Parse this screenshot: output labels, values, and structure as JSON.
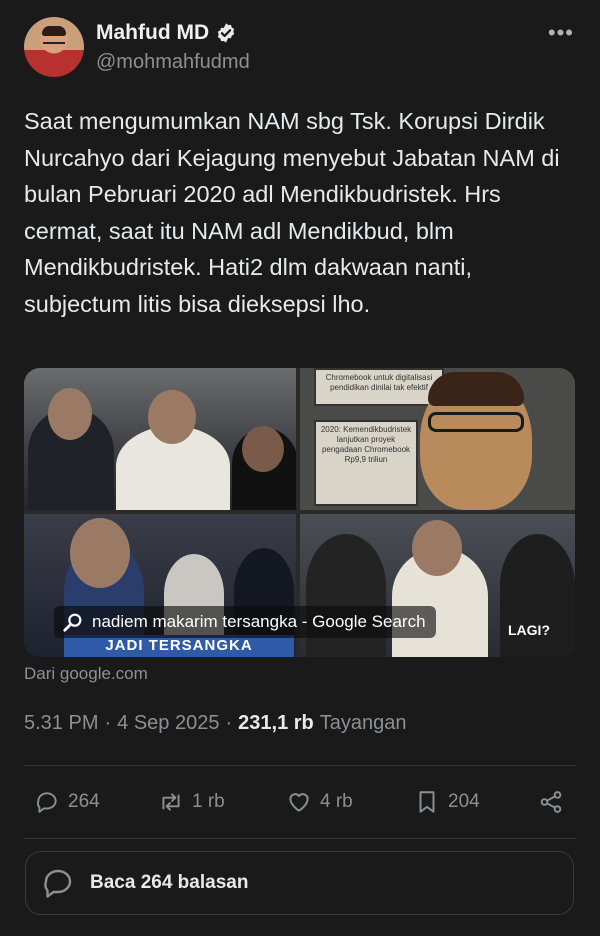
{
  "author": {
    "name": "Mahfud MD",
    "handle": "@mohmahfudmd"
  },
  "tweet": {
    "text": "Saat mengumumkan NAM sbg Tsk. Korupsi Dirdik Nurcahyo dari Kejagung menyebut Jabatan NAM di bulan Pebruari 2020 adl Mendikbudristek. Hrs cermat, saat itu NAM adl Mendikbud, blm Mendikbudristek. Hati2 dlm dakwaan nanti, subjectum litis bisa dieksepsi lho."
  },
  "media": {
    "search_chip": "nadiem makarim tersangka - Google Search",
    "source": "Dari google.com",
    "tile_texts": {
      "doc_top": "Chromebook untuk digitalisasi pendidikan dinilai tak efektif",
      "doc_bottom": "2020: Kemendikbudristek lanjutkan proyek pengadaan Chromebook Rp9,9 triliun",
      "banner": "JADI TERSANGKA",
      "lagi": "LAGI?"
    }
  },
  "meta": {
    "time": "5.31 PM",
    "separator": "·",
    "date": "4 Sep 2025",
    "views_count": "231,1 rb",
    "views_label": "Tayangan"
  },
  "actions": {
    "replies": "264",
    "reposts": "1 rb",
    "likes": "4 rb",
    "bookmarks": "204"
  },
  "reply_button": {
    "label": "Baca 264 balasan"
  },
  "colors": {
    "background": "#1a1a1a",
    "text": "#e7e9ea",
    "muted": "#8b9096",
    "verified": "#ffffff"
  },
  "icons": [
    "verified-icon",
    "more-icon",
    "search-icon",
    "reply-icon",
    "repost-icon",
    "like-icon",
    "bookmark-icon",
    "share-icon",
    "chat-bubble-icon"
  ]
}
